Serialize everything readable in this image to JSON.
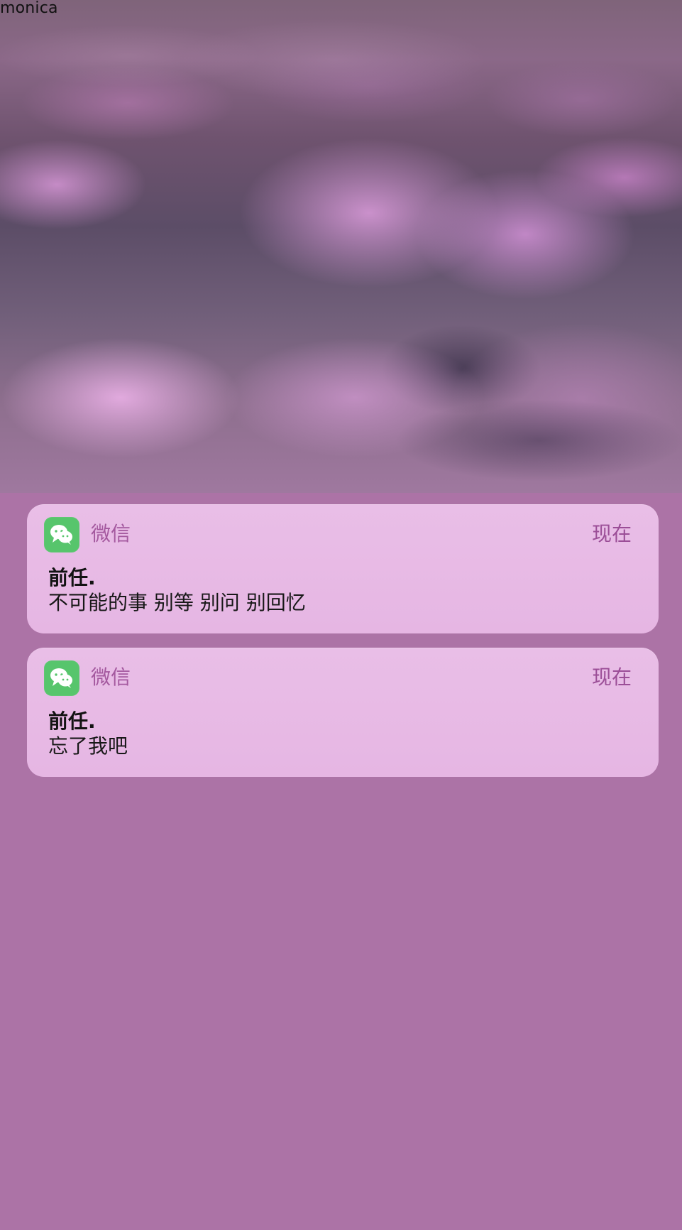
{
  "watermark": "monica",
  "notifications": [
    {
      "app_name": "微信",
      "time": "现在",
      "sender": "前任.",
      "message": "不可能的事 别等 别问 别回忆",
      "icon": "wechat-icon"
    },
    {
      "app_name": "微信",
      "time": "现在",
      "sender": "前任.",
      "message": "忘了我吧",
      "icon": "wechat-icon"
    }
  ],
  "colors": {
    "background": "#ac73a6",
    "card": "#e8b8e5",
    "wechat_green": "#57c56c",
    "app_name": "#a4599f",
    "time": "#9b4e97"
  }
}
